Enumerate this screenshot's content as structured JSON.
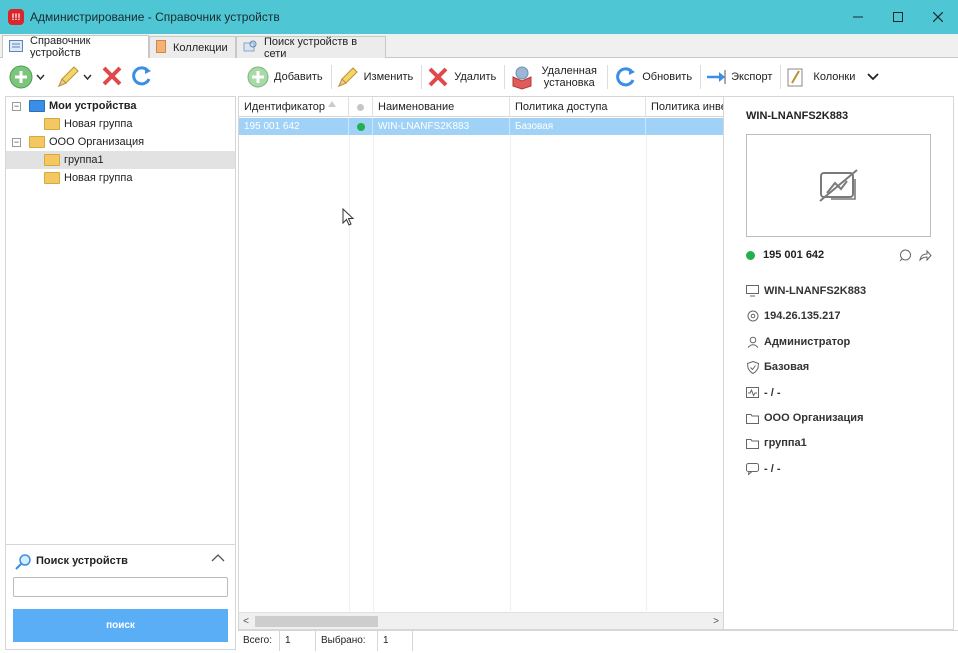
{
  "window": {
    "title": "Администрирование - Справочник устройств",
    "icon_text": "!!!",
    "controls": [
      "minimize-icon",
      "maximize-icon",
      "close-icon"
    ]
  },
  "tabs": [
    {
      "label": "Справочник устройств",
      "active": true
    },
    {
      "label": "Коллекции",
      "active": false
    },
    {
      "label": "Поиск устройств в сети",
      "active": false
    }
  ],
  "toolbar": {
    "add": "Добавить",
    "edit": "Изменить",
    "delete": "Удалить",
    "remote_install": "Удаленная установка",
    "refresh": "Обновить",
    "export": "Экспорт",
    "columns": "Колонки"
  },
  "tree": {
    "items": [
      {
        "label": "Мои устройства",
        "bold": true
      },
      {
        "label": "Новая группа"
      },
      {
        "label": "ООО Организация"
      },
      {
        "label": "группа1",
        "selected": true
      },
      {
        "label": "Новая группа"
      }
    ]
  },
  "search": {
    "title": "Поиск устройств",
    "placeholder": "",
    "button": "поиск"
  },
  "grid": {
    "columns": [
      "Идентификатор",
      "",
      "Наименование",
      "Политика доступа",
      "Политика инвен"
    ],
    "rows": [
      {
        "id": "195 001 642",
        "status": "online",
        "name": "WIN-LNANFS2K883",
        "policy": "Базовая",
        "inventory": ""
      }
    ]
  },
  "status": {
    "total_label": "Всего:",
    "total": "1",
    "selected_label": "Выбрано:",
    "selected": "1"
  },
  "detail": {
    "title": "WIN-LNANFS2K883",
    "id": "195 001 642",
    "status_color": "#22b14c",
    "hostname": "WIN-LNANFS2K883",
    "ip": "194.26.135.217",
    "user": "Администратор",
    "policy": "Базовая",
    "inventory": "- / -",
    "organization": "ООО Организация",
    "group": "группа1",
    "comment": "- / -"
  },
  "colors": {
    "titlebar": "#4ec6d4",
    "selection": "#9fd2f6",
    "search_button": "#5aaef6",
    "online": "#22b14c"
  }
}
